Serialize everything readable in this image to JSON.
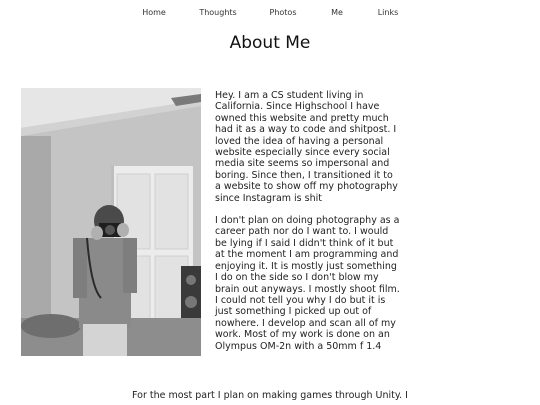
{
  "nav": {
    "items": [
      {
        "label": "Home"
      },
      {
        "label": "Thoughts"
      },
      {
        "label": "Photos"
      },
      {
        "label": "Me"
      },
      {
        "label": "Links"
      }
    ]
  },
  "page": {
    "title": "About Me"
  },
  "about": {
    "paragraph1": "Hey. I am a CS student living in California. Since Highschool I have owned this website and pretty much had it as a way to code and shitpost. I loved the idea of having a personal website especially since every social media site seems so impersonal and boring. Since then, I transitioned it to a website to show off my photography since Instagram is shit",
    "paragraph2": "I don't plan on doing photography as a career path nor do I want to. I would be lying if I said I didn't think of it but at the moment I am programming and enjoying it. It is mostly just something I do on the side so I don't blow my brain out anyways. I mostly shoot film. I could not tell you why I do but it is just something I picked up out of nowhere. I develop and scan all of my work. Most of my work is done on an Olympus OM-2n with a 50mm f 1.4",
    "paragraph3": "For the most part I plan on making games through Unity. I"
  },
  "photo": {
    "description_icon": "mirror-selfie-photo"
  }
}
